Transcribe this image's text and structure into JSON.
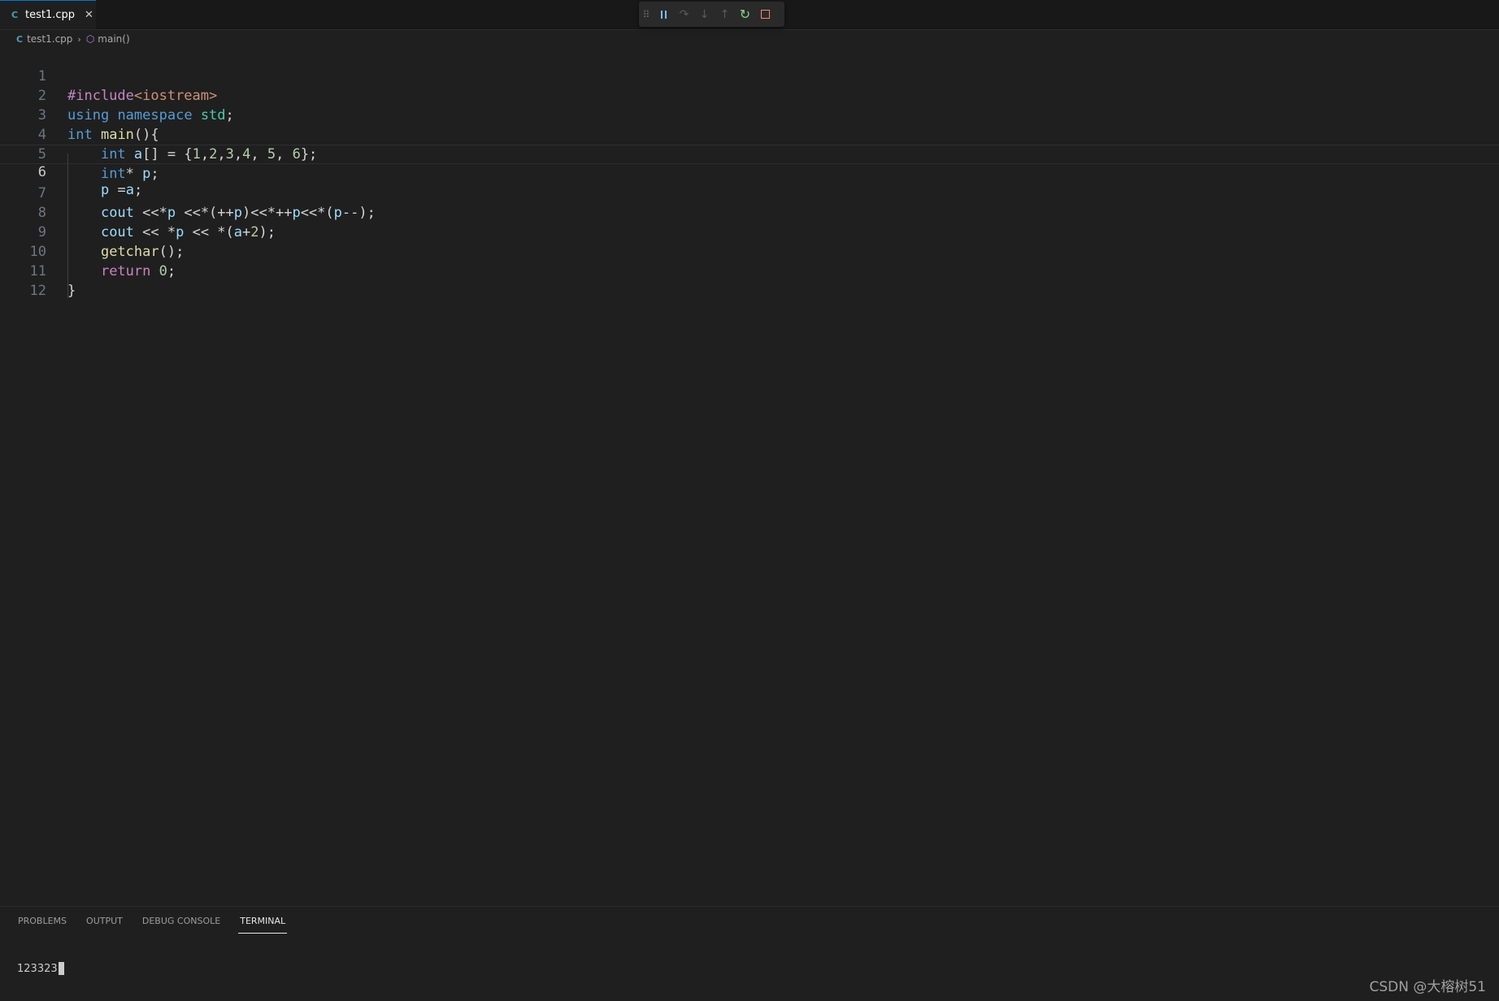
{
  "tab": {
    "label": "test1.cpp",
    "file_icon": "cpp-file-icon",
    "close_glyph": "✕"
  },
  "breadcrumb": {
    "file": "test1.cpp",
    "symbol": "main()"
  },
  "code": {
    "active_line": 6,
    "lines": [
      {
        "num": "1"
      },
      {
        "num": "2"
      },
      {
        "num": "3"
      },
      {
        "num": "4"
      },
      {
        "num": "5"
      },
      {
        "num": "6"
      },
      {
        "num": "7"
      },
      {
        "num": "8"
      },
      {
        "num": "9"
      },
      {
        "num": "10"
      },
      {
        "num": "11"
      },
      {
        "num": "12"
      }
    ],
    "tokens": {
      "l1_include": "#include",
      "l1_header": "<iostream>",
      "l2_using": "using",
      "l2_namespace": "namespace",
      "l2_std": "std",
      "l2_semi": ";",
      "l3_int": "int",
      "l3_main": "main",
      "l3_rest": "(){",
      "l4_int": "int",
      "l4_a": "a",
      "l4_brackets": "[] = {",
      "l4_n1": "1",
      "l4_n2": "2",
      "l4_n3": "3",
      "l4_n4": "4",
      "l4_n5": "5",
      "l4_n6": "6",
      "l4_end": "};",
      "l5_int": "int",
      "l5_star": "* ",
      "l5_p": "p",
      "l5_semi": ";",
      "l6_p": "p",
      "l6_eq": " =",
      "l6_a": "a",
      "l6_semi": ";",
      "l7_cout": "cout",
      "l7_op1": " <<*",
      "l7_p1": "p",
      "l7_op2": " <<*(++",
      "l7_p2": "p",
      "l7_op3": ")<<*++",
      "l7_p3": "p",
      "l7_op4": "<<*(",
      "l7_p4": "p",
      "l7_op5": "--);",
      "l8_cout": "cout",
      "l8_op1": " << *",
      "l8_p": "p",
      "l8_op2": " << *(",
      "l8_a": "a",
      "l8_plus": "+",
      "l8_two": "2",
      "l8_end": ");",
      "l9_getchar": "getchar",
      "l9_end": "();",
      "l10_return": "return",
      "l10_zero": "0",
      "l10_semi": ";",
      "l11_close": "}"
    }
  },
  "debug_toolbar": {
    "icons": [
      "grip-icon",
      "pause-icon",
      "step-over-icon",
      "step-into-icon",
      "step-out-icon",
      "restart-icon",
      "stop-icon"
    ]
  },
  "panel": {
    "tabs": [
      "PROBLEMS",
      "OUTPUT",
      "DEBUG CONSOLE",
      "TERMINAL"
    ],
    "active_tab": "TERMINAL",
    "terminal_output": "123323"
  },
  "watermark": "CSDN @大榕树51",
  "colors": {
    "editor_bg": "#1f1f1f",
    "keyword_purple": "#c586c0",
    "keyword_blue": "#569cd6",
    "string": "#ce9178",
    "type": "#4ec9b0",
    "function": "#dcdcaa",
    "variable": "#9cdcfe",
    "number": "#b5cea8",
    "accent": "#0078d4"
  }
}
